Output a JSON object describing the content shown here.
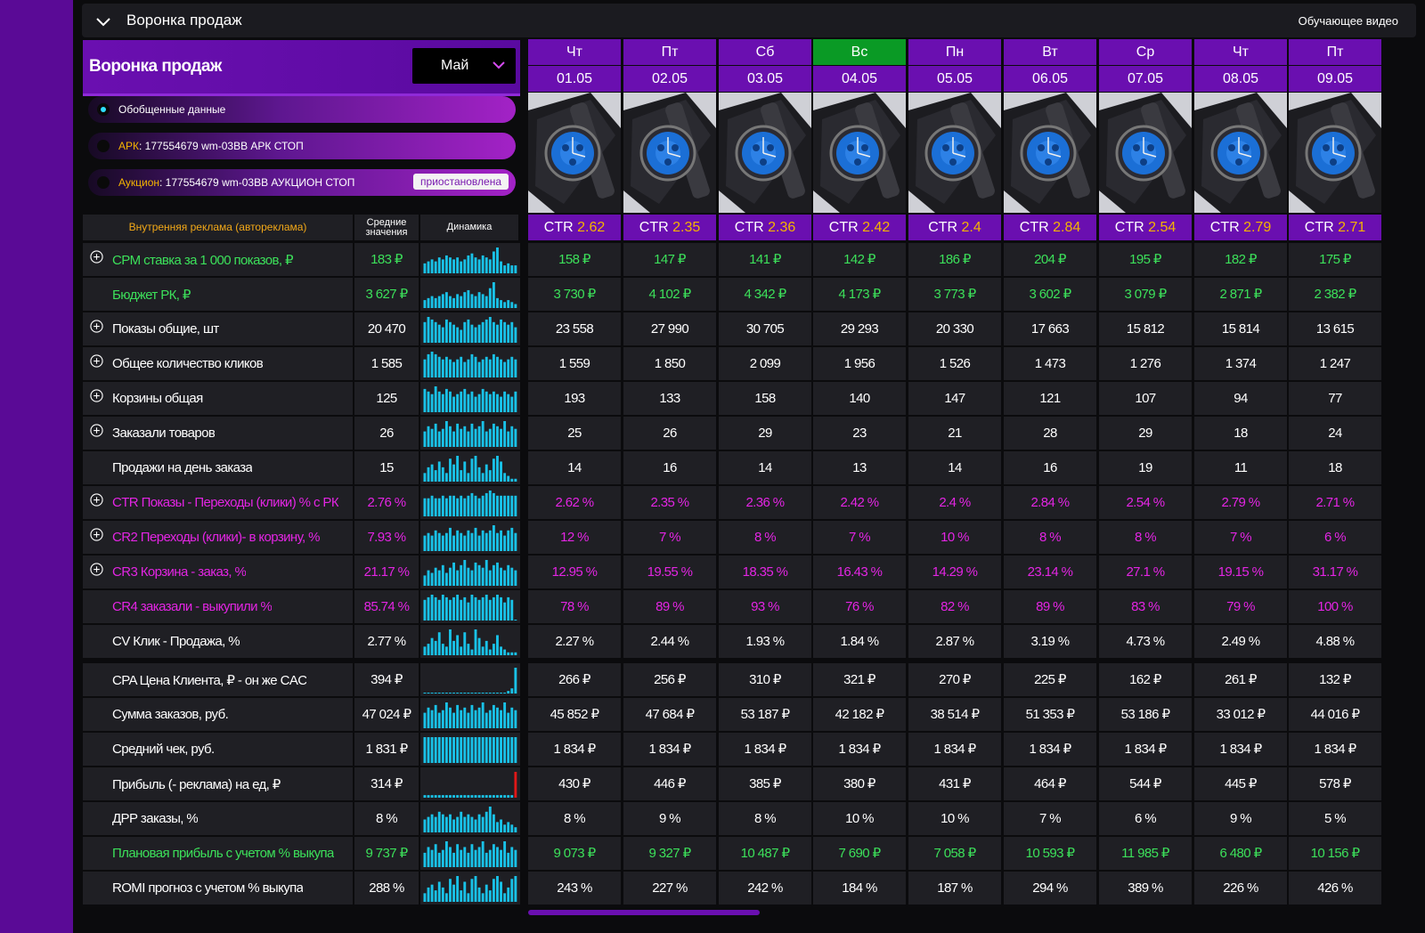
{
  "topbar": {
    "title": "Воронка продаж",
    "video_link": "Обучающее видео"
  },
  "funnel": {
    "title": "Воронка продаж",
    "month": "Май",
    "options": [
      {
        "tag": "",
        "text": "Обобщенные данные",
        "selected": true,
        "badge": ""
      },
      {
        "tag": "АРК",
        "text": ": 177554679 wm-03BB АРК СТОП",
        "selected": false,
        "badge": ""
      },
      {
        "tag": "Аукцион",
        "text": ": 177554679 wm-03BB АУКЦИОН СТОП",
        "selected": false,
        "badge": "приостановлена"
      }
    ]
  },
  "table_header": {
    "metric": "Внутренняя реклама (автореклама)",
    "avg_line1": "Средние",
    "avg_line2": "значения",
    "dynamics": "Динамика"
  },
  "colors": {
    "purple": "#6a0fb0",
    "green_day": "#0a9a25",
    "green_text": "#3ce05a",
    "pink_text": "#e325e3",
    "ctr_value": "#f5b400",
    "spark": "#19c2e8"
  },
  "days": [
    {
      "weekday": "Чт",
      "date": "01.05",
      "ctr_label": "CTR",
      "ctr": "2.62",
      "highlight": false
    },
    {
      "weekday": "Пт",
      "date": "02.05",
      "ctr_label": "CTR",
      "ctr": "2.35",
      "highlight": false
    },
    {
      "weekday": "Сб",
      "date": "03.05",
      "ctr_label": "CTR",
      "ctr": "2.36",
      "highlight": false
    },
    {
      "weekday": "Вс",
      "date": "04.05",
      "ctr_label": "CTR",
      "ctr": "2.42",
      "highlight": true
    },
    {
      "weekday": "Пн",
      "date": "05.05",
      "ctr_label": "CTR",
      "ctr": "2.4",
      "highlight": false
    },
    {
      "weekday": "Вт",
      "date": "06.05",
      "ctr_label": "CTR",
      "ctr": "2.84",
      "highlight": false
    },
    {
      "weekday": "Ср",
      "date": "07.05",
      "ctr_label": "CTR",
      "ctr": "2.54",
      "highlight": false
    },
    {
      "weekday": "Чт",
      "date": "08.05",
      "ctr_label": "CTR",
      "ctr": "2.79",
      "highlight": false
    },
    {
      "weekday": "Пт",
      "date": "09.05",
      "ctr_label": "CTR",
      "ctr": "2.71",
      "highlight": false
    }
  ],
  "rows": [
    {
      "name": "CPM ставка за 1 000 показов, ₽",
      "expandable": true,
      "color": "green",
      "avg": "183 ₽",
      "values": [
        "158 ₽",
        "147 ₽",
        "141 ₽",
        "142 ₽",
        "186 ₽",
        "204 ₽",
        "195 ₽",
        "182 ₽",
        "175 ₽"
      ],
      "spark": [
        5,
        6,
        7,
        6,
        8,
        7,
        9,
        8,
        7,
        8,
        6,
        7,
        9,
        10,
        8,
        7,
        9,
        8,
        7,
        11,
        13,
        6,
        4,
        5,
        4,
        4
      ]
    },
    {
      "name": "Бюджет РК, ₽",
      "expandable": false,
      "color": "green",
      "avg": "3 627 ₽",
      "values": [
        "3 730 ₽",
        "4 102 ₽",
        "4 342 ₽",
        "4 173 ₽",
        "3 773 ₽",
        "3 602 ₽",
        "3 079 ₽",
        "2 871 ₽",
        "2 382 ₽"
      ],
      "spark": [
        4,
        5,
        6,
        5,
        6,
        7,
        8,
        6,
        5,
        7,
        6,
        8,
        9,
        7,
        6,
        8,
        7,
        6,
        10,
        13,
        5,
        4,
        3,
        4,
        3,
        2
      ]
    },
    {
      "name": "Показы общие, шт",
      "expandable": true,
      "color": "white",
      "avg": "20 470",
      "values": [
        "23 558",
        "27 990",
        "30 705",
        "29 293",
        "20 330",
        "17 663",
        "15 812",
        "15 814",
        "13 615"
      ],
      "spark": [
        8,
        10,
        9,
        8,
        7,
        6,
        9,
        8,
        7,
        6,
        5,
        8,
        9,
        7,
        6,
        7,
        8,
        9,
        10,
        8,
        7,
        9,
        8,
        7,
        8,
        6
      ]
    },
    {
      "name": "Общее количество кликов",
      "expandable": true,
      "color": "white",
      "avg": "1 585",
      "values": [
        "1 559",
        "1 850",
        "2 099",
        "1 956",
        "1 526",
        "1 473",
        "1 276",
        "1 374",
        "1 247"
      ],
      "spark": [
        7,
        9,
        10,
        9,
        8,
        7,
        8,
        7,
        6,
        7,
        8,
        6,
        7,
        9,
        8,
        6,
        7,
        8,
        7,
        9,
        8,
        7,
        6,
        7,
        8,
        7
      ]
    },
    {
      "name": "Корзины общая",
      "expandable": true,
      "color": "white",
      "avg": "125",
      "values": [
        "193",
        "133",
        "158",
        "140",
        "147",
        "121",
        "107",
        "94",
        "77"
      ],
      "spark": [
        9,
        8,
        7,
        10,
        8,
        7,
        9,
        8,
        6,
        7,
        8,
        9,
        7,
        8,
        6,
        7,
        9,
        8,
        7,
        8,
        7,
        6,
        8,
        7,
        6,
        8
      ]
    },
    {
      "name": "Заказали товаров",
      "expandable": true,
      "color": "white",
      "avg": "26",
      "values": [
        "25",
        "26",
        "29",
        "23",
        "21",
        "28",
        "29",
        "18",
        "24"
      ],
      "spark": [
        6,
        8,
        7,
        9,
        6,
        7,
        10,
        8,
        6,
        9,
        7,
        8,
        6,
        9,
        7,
        8,
        10,
        6,
        7,
        9,
        8,
        7,
        10,
        6,
        8,
        7
      ]
    },
    {
      "name": "Продажи на день заказа",
      "expandable": false,
      "color": "white",
      "avg": "15",
      "values": [
        "14",
        "16",
        "14",
        "13",
        "14",
        "16",
        "19",
        "11",
        "18"
      ],
      "spark": [
        3,
        5,
        6,
        4,
        7,
        5,
        3,
        8,
        6,
        9,
        4,
        7,
        3,
        8,
        9,
        5,
        3,
        6,
        4,
        8,
        9,
        7,
        3,
        2,
        1,
        1
      ]
    },
    {
      "name": "CTR Показы - Переходы (клики) % с РК",
      "expandable": true,
      "color": "pink",
      "avg": "2.76 %",
      "values": [
        "2.62 %",
        "2.35 %",
        "2.36 %",
        "2.42 %",
        "2.4 %",
        "2.84 %",
        "2.54 %",
        "2.79 %",
        "2.71 %"
      ],
      "spark": [
        7,
        7,
        8,
        7,
        7,
        8,
        7,
        8,
        8,
        7,
        8,
        7,
        8,
        9,
        8,
        7,
        8,
        9,
        10,
        9,
        8,
        8,
        8,
        8,
        8,
        8
      ]
    },
    {
      "name": "CR2 Переходы (клики)- в корзину, %",
      "expandable": true,
      "color": "pink",
      "avg": "7.93 %",
      "values": [
        "12 %",
        "7 %",
        "8 %",
        "7 %",
        "10 %",
        "8 %",
        "8 %",
        "7 %",
        "6 %"
      ],
      "spark": [
        6,
        7,
        6,
        8,
        7,
        6,
        7,
        9,
        6,
        8,
        7,
        6,
        8,
        7,
        9,
        6,
        8,
        7,
        8,
        10,
        7,
        8,
        6,
        8,
        9,
        7
      ]
    },
    {
      "name": "CR3 Корзина - заказ, %",
      "expandable": true,
      "color": "pink",
      "avg": "21.17 %",
      "values": [
        "12.95 %",
        "19.55 %",
        "18.35 %",
        "16.43 %",
        "14.29 %",
        "23.14 %",
        "27.1 %",
        "19.15 %",
        "31.17 %"
      ],
      "spark": [
        4,
        6,
        5,
        7,
        6,
        8,
        5,
        7,
        9,
        6,
        8,
        10,
        7,
        6,
        9,
        8,
        7,
        10,
        6,
        8,
        9,
        7,
        6,
        8,
        7,
        6
      ]
    },
    {
      "name": "CR4 заказали - выкупили %",
      "expandable": false,
      "color": "pink",
      "avg": "85.74 %",
      "values": [
        "78 %",
        "89 %",
        "93 %",
        "76 %",
        "82 %",
        "89 %",
        "83 %",
        "79 %",
        "100 %"
      ],
      "spark": [
        8,
        9,
        10,
        9,
        8,
        10,
        9,
        8,
        9,
        10,
        8,
        9,
        7,
        10,
        9,
        8,
        9,
        10,
        8,
        9,
        10,
        9,
        7,
        9,
        8,
        0
      ]
    },
    {
      "name": "CV Клик - Продажа, %",
      "expandable": false,
      "color": "white",
      "avg": "2.77 %",
      "values": [
        "2.27 %",
        "2.44 %",
        "1.93 %",
        "1.84 %",
        "2.87 %",
        "3.19 %",
        "4.73 %",
        "2.49 %",
        "4.88 %"
      ],
      "spark": [
        3,
        4,
        6,
        5,
        8,
        4,
        3,
        9,
        5,
        7,
        3,
        8,
        4,
        2,
        9,
        6,
        3,
        5,
        2,
        4,
        7,
        3,
        2,
        1,
        1,
        1
      ]
    },
    {
      "name": "CPA Цена Клиента, ₽ - он же CAC",
      "expandable": false,
      "color": "white",
      "avg": "394 ₽",
      "values": [
        "266 ₽",
        "256 ₽",
        "310 ₽",
        "321 ₽",
        "270 ₽",
        "225 ₽",
        "162 ₽",
        "261 ₽",
        "132 ₽"
      ],
      "spark": [
        0,
        0,
        0,
        0,
        0,
        0,
        0,
        0,
        0,
        0,
        0,
        0,
        0,
        0,
        0,
        0,
        0,
        0,
        0,
        0,
        0,
        0,
        0,
        1,
        2,
        10
      ]
    },
    {
      "name": "Сумма заказов, руб.",
      "expandable": false,
      "color": "white",
      "avg": "47 024 ₽",
      "values": [
        "45 852 ₽",
        "47 684 ₽",
        "53 187 ₽",
        "42 182 ₽",
        "38 514 ₽",
        "51 353 ₽",
        "53 186 ₽",
        "33 012 ₽",
        "44 016 ₽"
      ],
      "spark": [
        6,
        8,
        7,
        9,
        6,
        7,
        10,
        8,
        6,
        9,
        7,
        8,
        6,
        9,
        7,
        8,
        10,
        6,
        7,
        9,
        8,
        7,
        10,
        6,
        8,
        7
      ]
    },
    {
      "name": "Средний чек, руб.",
      "expandable": false,
      "color": "white",
      "avg": "1 831 ₽",
      "values": [
        "1 834 ₽",
        "1 834 ₽",
        "1 834 ₽",
        "1 834 ₽",
        "1 834 ₽",
        "1 834 ₽",
        "1 834 ₽",
        "1 834 ₽",
        "1 834 ₽"
      ],
      "spark": [
        10,
        10,
        10,
        10,
        10,
        10,
        10,
        10,
        10,
        10,
        10,
        10,
        10,
        10,
        10,
        10,
        10,
        10,
        10,
        10,
        10,
        10,
        10,
        10,
        10,
        10
      ]
    },
    {
      "name": "Прибыль (- реклама) на ед, ₽",
      "expandable": false,
      "color": "white",
      "avg": "314 ₽",
      "values": [
        "430 ₽",
        "446 ₽",
        "385 ₽",
        "380 ₽",
        "431 ₽",
        "464 ₽",
        "544 ₽",
        "445 ₽",
        "578 ₽"
      ],
      "spark": [
        1,
        1,
        1,
        1,
        1,
        1,
        1,
        1,
        1,
        1,
        1,
        1,
        1,
        1,
        1,
        1,
        1,
        1,
        1,
        1,
        1,
        1,
        1,
        1,
        1,
        10
      ]
    },
    {
      "name": "ДРР заказы, %",
      "expandable": false,
      "color": "white",
      "avg": "8 %",
      "values": [
        "8 %",
        "9 %",
        "8 %",
        "10 %",
        "10 %",
        "7 %",
        "6 %",
        "9 %",
        "5 %"
      ],
      "spark": [
        5,
        6,
        7,
        6,
        8,
        7,
        6,
        7,
        5,
        6,
        8,
        6,
        7,
        6,
        5,
        7,
        6,
        8,
        10,
        7,
        4,
        5,
        3,
        4,
        3,
        2
      ]
    },
    {
      "name": "Плановая прибыль с учетом % выкупа",
      "expandable": false,
      "color": "green",
      "avg": "9 737 ₽",
      "values": [
        "9 073 ₽",
        "9 327 ₽",
        "10 487 ₽",
        "7 690 ₽",
        "7 058 ₽",
        "10 593 ₽",
        "11 985 ₽",
        "6 480 ₽",
        "10 156 ₽"
      ],
      "spark": [
        5,
        7,
        6,
        8,
        5,
        6,
        9,
        7,
        5,
        8,
        6,
        7,
        5,
        8,
        6,
        7,
        9,
        5,
        6,
        8,
        7,
        6,
        9,
        5,
        7,
        6
      ]
    },
    {
      "name": "ROMI прогноз с учетом % выкупа",
      "expandable": false,
      "color": "white",
      "avg": "288 %",
      "values": [
        "243 %",
        "227 %",
        "242 %",
        "184 %",
        "187 %",
        "294 %",
        "389 %",
        "226 %",
        "426 %"
      ],
      "spark": [
        3,
        5,
        6,
        4,
        7,
        5,
        3,
        8,
        6,
        9,
        4,
        7,
        3,
        8,
        9,
        5,
        3,
        6,
        4,
        8,
        9,
        7,
        3,
        5,
        8,
        9
      ]
    }
  ]
}
